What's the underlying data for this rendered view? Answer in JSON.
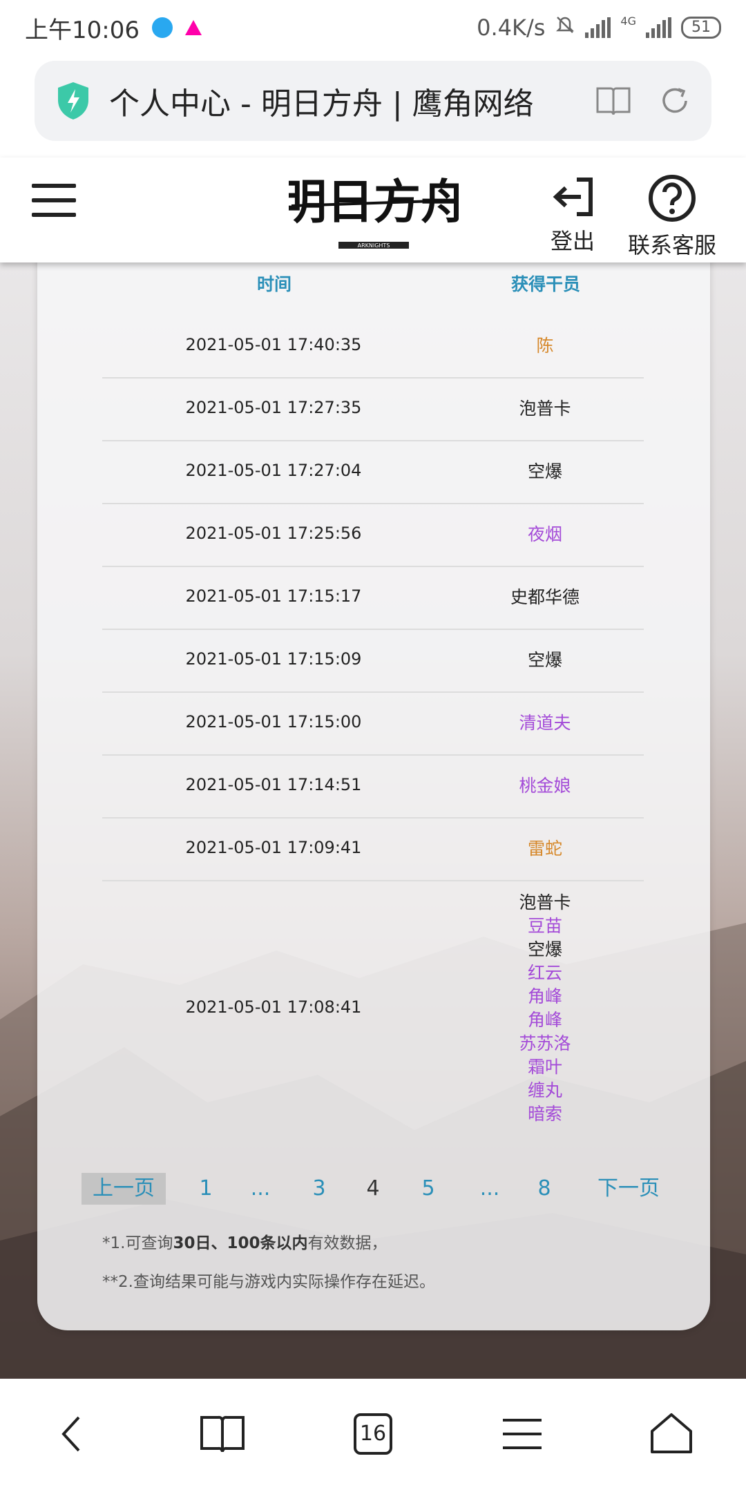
{
  "status_bar": {
    "time": "上午10:06",
    "speed": "0.4K/s",
    "network": "4G",
    "battery": "51"
  },
  "browser": {
    "page_title": "个人中心 - 明日方舟 | 鹰角网络"
  },
  "header": {
    "logo_text": "明日方舟",
    "logo_subtext": "ARKNIGHTS",
    "logout_label": "登出",
    "support_label": "联系客服"
  },
  "table": {
    "headers": {
      "time": "时间",
      "operators": "获得干员"
    },
    "rows": [
      {
        "time": "2021-05-01 17:40:35",
        "operators": [
          {
            "name": "陈",
            "color": "orange"
          }
        ]
      },
      {
        "time": "2021-05-01 17:27:35",
        "operators": [
          {
            "name": "泡普卡",
            "color": "black"
          }
        ]
      },
      {
        "time": "2021-05-01 17:27:04",
        "operators": [
          {
            "name": "空爆",
            "color": "black"
          }
        ]
      },
      {
        "time": "2021-05-01 17:25:56",
        "operators": [
          {
            "name": "夜烟",
            "color": "purple"
          }
        ]
      },
      {
        "time": "2021-05-01 17:15:17",
        "operators": [
          {
            "name": "史都华德",
            "color": "black"
          }
        ]
      },
      {
        "time": "2021-05-01 17:15:09",
        "operators": [
          {
            "name": "空爆",
            "color": "black"
          }
        ]
      },
      {
        "time": "2021-05-01 17:15:00",
        "operators": [
          {
            "name": "清道夫",
            "color": "purple"
          }
        ]
      },
      {
        "time": "2021-05-01 17:14:51",
        "operators": [
          {
            "name": "桃金娘",
            "color": "purple"
          }
        ]
      },
      {
        "time": "2021-05-01 17:09:41",
        "operators": [
          {
            "name": "雷蛇",
            "color": "orange"
          }
        ]
      },
      {
        "time": "2021-05-01 17:08:41",
        "operators": [
          {
            "name": "泡普卡",
            "color": "black"
          },
          {
            "name": "豆苗",
            "color": "purple"
          },
          {
            "name": "空爆",
            "color": "black"
          },
          {
            "name": "红云",
            "color": "purple"
          },
          {
            "name": "角峰",
            "color": "purple"
          },
          {
            "name": "角峰",
            "color": "purple"
          },
          {
            "name": "苏苏洛",
            "color": "purple"
          },
          {
            "name": "霜叶",
            "color": "purple"
          },
          {
            "name": "缠丸",
            "color": "purple"
          },
          {
            "name": "暗索",
            "color": "purple"
          }
        ]
      }
    ]
  },
  "pagination": {
    "prev": "上一页",
    "p1": "1",
    "dots1": "...",
    "p3": "3",
    "p4": "4",
    "p5": "5",
    "dots2": "...",
    "p8": "8",
    "next": "下一页",
    "current": "4"
  },
  "notes": {
    "note1_prefix": "*1.可查询",
    "note1_bold1": "30日",
    "note1_sep": "、",
    "note1_bold2": "100条以内",
    "note1_suffix": "有效数据，",
    "note2": "**2.查询结果可能与游戏内实际操作存在延迟。"
  },
  "bottom_nav": {
    "tab_count": "16"
  },
  "colors": {
    "orange": "#d6882a",
    "purple": "#a44bd8",
    "accent": "#2a8fb8"
  }
}
